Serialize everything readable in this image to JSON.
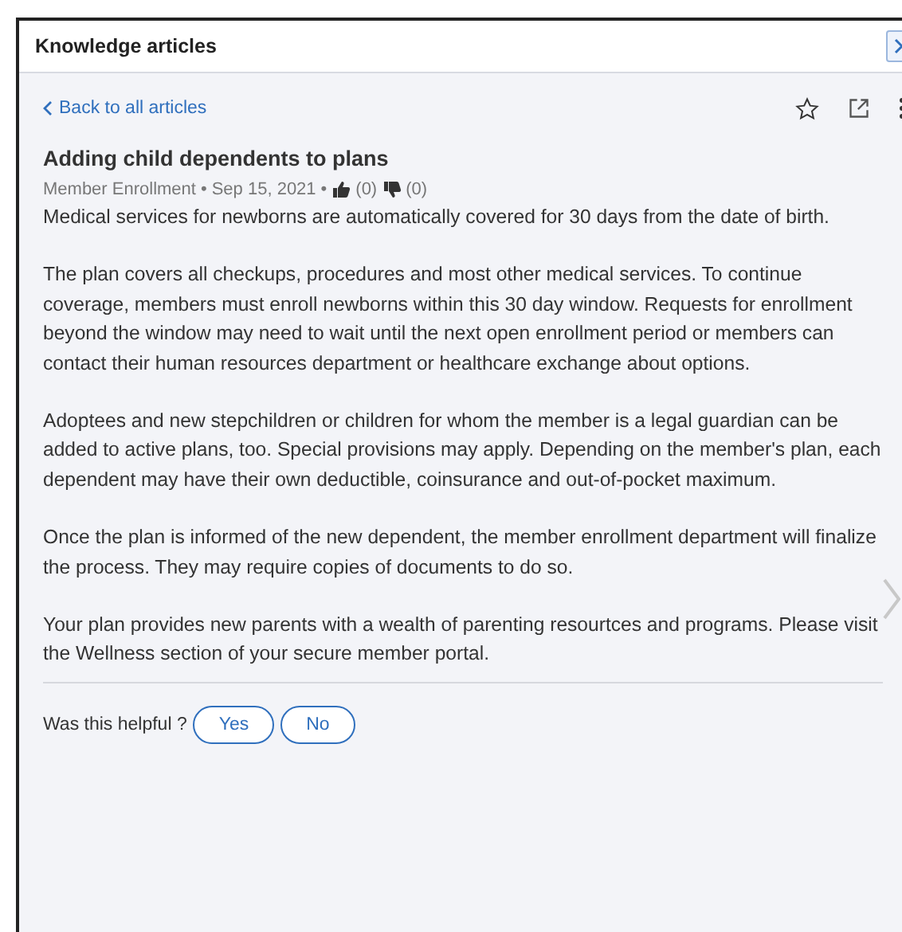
{
  "panel": {
    "title": "Knowledge articles"
  },
  "back_link": "Back to all articles",
  "article": {
    "title": "Adding child dependents to plans",
    "category": "Member Enrollment",
    "date": "Sep 15, 2021",
    "separators": [
      "•",
      "•"
    ],
    "likes": "(0)",
    "dislikes": "(0)",
    "paragraphs": [
      "Medical services for newborns are automatically covered for 30 days from the date of birth.",
      "The plan covers all checkups, procedures and most other medical services. To continue coverage, members must enroll newborns within this 30 day window.  Requests for enrollment beyond the window may need to wait until the next open enrollment period or members can contact their human resources department or healthcare exchange about options.",
      "Adoptees and new stepchildren or children for whom the member is a legal guardian can be added to active plans, too. Special provisions may apply. Depending on the member's plan, each dependent may have their own deductible, coinsurance and out-of-pocket maximum.",
      "Once the plan is informed of the new dependent, the member enrollment department will finalize the process. They may require copies of documents to do so.",
      "Your plan provides new parents with a wealth of parenting resourtces and programs. Please visit the Wellness section of your secure member portal."
    ]
  },
  "feedback": {
    "question": "Was this helpful ?",
    "buttons": [
      "Yes",
      "No"
    ]
  }
}
